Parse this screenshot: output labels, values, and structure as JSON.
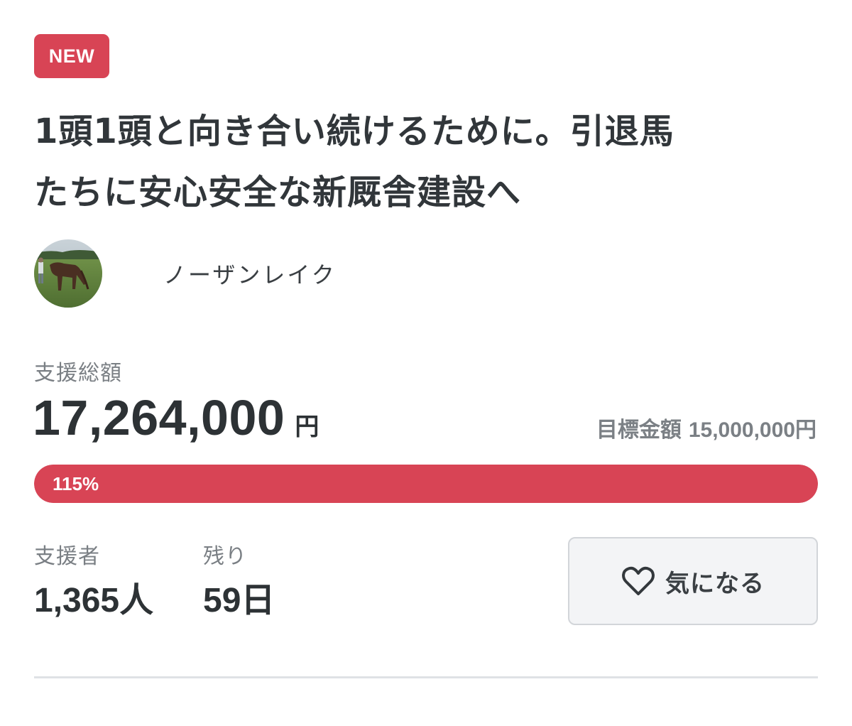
{
  "badge": "NEW",
  "project": {
    "title_line1": "1頭1頭と向き合い続けるために。引退馬",
    "title_line2": "たちに安心安全な新厩舎建設へ"
  },
  "owner": {
    "name": "ノーザンレイク"
  },
  "funding": {
    "total_label": "支援総額",
    "total_amount": "17,264,000",
    "currency_unit": "円",
    "goal_label": "目標金額",
    "goal_amount": "15,000,000円",
    "progress_text": "115%",
    "progress_fraction": 1.0
  },
  "stats": {
    "supporters_label": "支援者",
    "supporters_value": "1,365人",
    "remaining_label": "残り",
    "remaining_value": "59日"
  },
  "favorite": {
    "label": "気になる",
    "icon": "heart-outline-icon"
  },
  "colors": {
    "accent": "#d84455",
    "text": "#2d3235",
    "muted": "#7a7f84"
  }
}
